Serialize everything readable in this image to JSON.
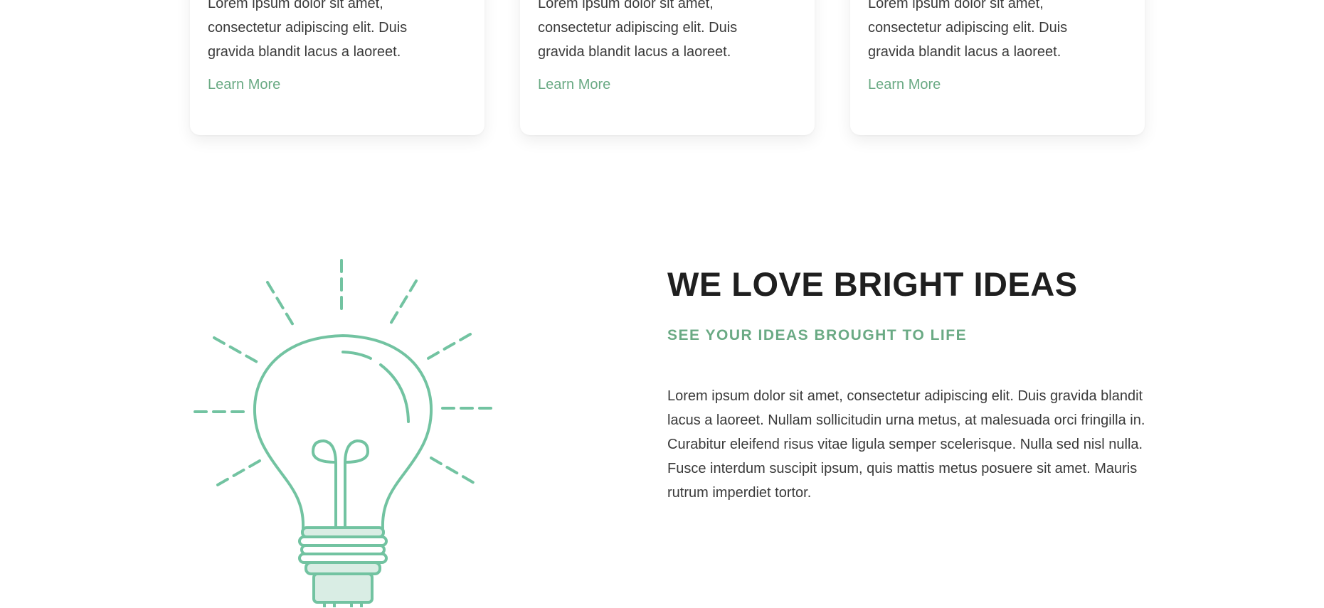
{
  "colors": {
    "accent": "#6aaa84",
    "bulb_stroke": "#72c3a1",
    "bulb_fill": "#d9ede4",
    "heading": "#1f1f1f",
    "text": "#3a3a3a"
  },
  "cards": [
    {
      "text": "Lorem ipsum dolor sit amet, consectetur adipiscing elit. Duis gravida blandit lacus a laoreet.",
      "link_label": "Learn More"
    },
    {
      "text": "Lorem ipsum dolor sit amet, consectetur adipiscing elit. Duis gravida blandit lacus a laoreet.",
      "link_label": "Learn More"
    },
    {
      "text": "Lorem ipsum dolor sit amet, consectetur adipiscing elit. Duis gravida blandit lacus a laoreet.",
      "link_label": "Learn More"
    }
  ],
  "feature": {
    "illustration": "lightbulb-icon",
    "title": "WE LOVE BRIGHT IDEAS",
    "subtitle": "SEE YOUR IDEAS BROUGHT TO LIFE",
    "body": [
      "Lorem ipsum dolor sit amet, consectetur adipiscing elit. Duis gravida blandit lacus a laoreet. Nullam sollicitudin urna metus, at malesuada orci fringilla in. Curabitur eleifend risus vitae ligula semper scelerisque. Nulla sed nisl nulla.",
      "Fusce interdum suscipit ipsum, quis mattis metus posuere sit amet. Mauris rutrum imperdiet tortor."
    ]
  }
}
